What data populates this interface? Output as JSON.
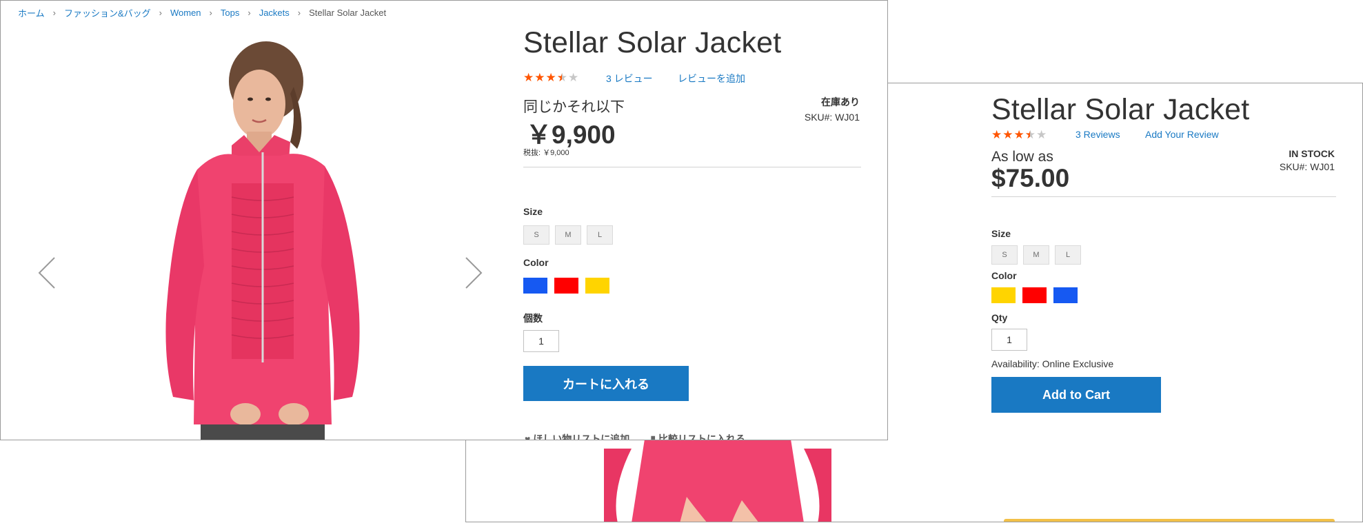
{
  "jp_page": {
    "breadcrumb": [
      "ホーム",
      "ファッション&バッグ",
      "Women",
      "Tops",
      "Jackets",
      "Stellar Solar Jacket"
    ],
    "title": "Stellar Solar Jacket",
    "rating_stars": 3.5,
    "reviews_count_label": "3  レビュー",
    "add_review_label": "レビューを追加",
    "price_label": "同じかそれ以下",
    "price": "￥9,900",
    "tax_note": "税抜: ￥9,000",
    "stock": "在庫あり",
    "sku": "SKU#:   WJ01",
    "size_label": "Size",
    "sizes": [
      "S",
      "M",
      "L"
    ],
    "color_label": "Color",
    "colors": [
      "#1659f2",
      "#ff0000",
      "#ffd400"
    ],
    "qty_label": "個数",
    "qty_value": "1",
    "add_to_cart": "カートに入れる",
    "wishlist": "ほしい物リストに追加",
    "compare": "比較リストに入れる"
  },
  "en_page": {
    "title": "Stellar Solar Jacket",
    "rating_stars": 3.5,
    "reviews_count_label": "3  Reviews",
    "add_review_label": "Add Your Review",
    "price_label": "As low as",
    "price": "$75.00",
    "stock": "IN STOCK",
    "sku": "SKU#:   WJ01",
    "size_label": "Size",
    "sizes": [
      "S",
      "M",
      "L"
    ],
    "color_label": "Color",
    "colors": [
      "#ffd400",
      "#ff0000",
      "#1659f2"
    ],
    "qty_label": "Qty",
    "qty_value": "1",
    "availability": "Availability: Online Exclusive",
    "add_to_cart": "Add to Cart"
  },
  "icons": {
    "prev": "chevron-left-icon",
    "next": "chevron-right-icon",
    "wishlist": "heart-icon",
    "compare": "bar-chart-icon"
  },
  "colors": {
    "accent": "#1979c3",
    "star": "#ff5501",
    "jacket": "#f0436f"
  }
}
